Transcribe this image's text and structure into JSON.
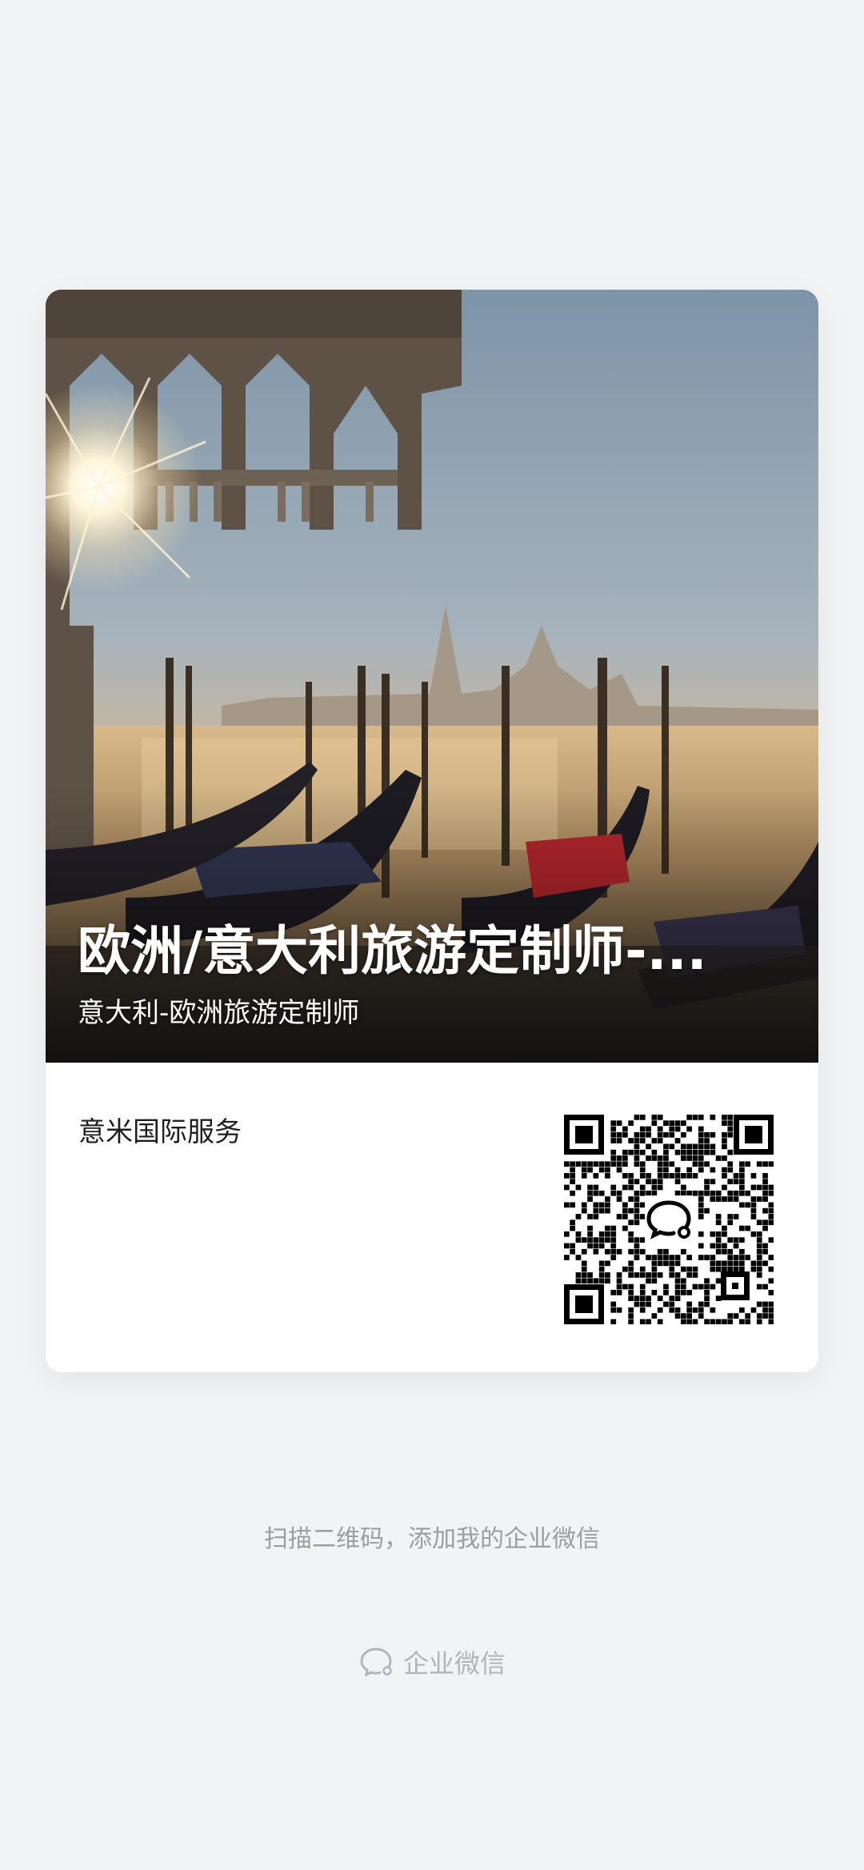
{
  "card": {
    "title": "欧洲/意大利旅游定制师-...",
    "subtitle": "意大利-欧洲旅游定制师",
    "company": "意米国际服务"
  },
  "footer": {
    "hint": "扫描二维码，添加我的企业微信",
    "brand_label": "企业微信"
  },
  "icons": {
    "qr_center": "wecom-logo-icon",
    "brand": "wecom-logo-icon"
  },
  "colors": {
    "background": "#f2f3f5",
    "card": "#ffffff",
    "hint_text": "#9a9da3"
  }
}
